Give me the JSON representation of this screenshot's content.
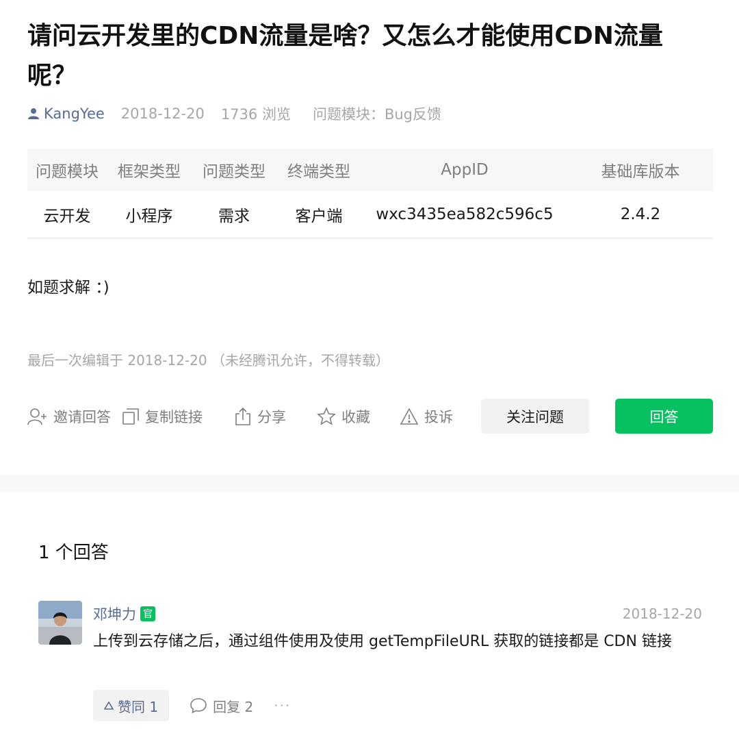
{
  "question": {
    "title": "请问云开发里的CDN流量是啥？又怎么才能使用CDN流量呢？",
    "author": "KangYee",
    "date": "2018-12-20",
    "views": "1736 浏览",
    "module_label": "问题模块：",
    "module_value": "Bug反馈"
  },
  "info_table": {
    "headers": [
      "问题模块",
      "框架类型",
      "问题类型",
      "终端类型",
      "AppID",
      "基础库版本"
    ],
    "values": [
      "云开发",
      "小程序",
      "需求",
      "客户端",
      "wxc3435ea582c596c5",
      "2.4.2"
    ]
  },
  "content": "如题求解 ：)",
  "edit_note": "最后一次编辑于  2018-12-20  （未经腾讯允许，不得转载）",
  "actions": {
    "invite": "邀请回答",
    "copy_link": "复制链接",
    "share": "分享",
    "favorite": "收藏",
    "report": "投诉",
    "follow": "关注问题",
    "answer": "回答"
  },
  "answers_heading": "1 个回答",
  "answer": {
    "name": "邓坤力",
    "badge": "官",
    "date": "2018-12-20",
    "text": "上传到云存储之后，通过组件使用及使用 getTempFileURL 获取的链接都是 CDN 链接",
    "like": "赞同 1",
    "reply": "回复 2",
    "more": "···"
  },
  "colors": {
    "brand_green": "#07c160",
    "link_blue": "#576b95",
    "muted_gray": "#a6a6a6"
  }
}
